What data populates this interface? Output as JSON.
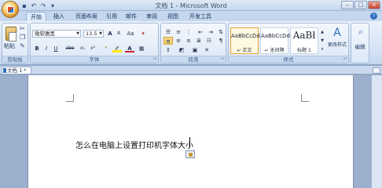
{
  "window": {
    "title": "文档 1 - Microsoft Word",
    "buttons": {
      "minimize": "–",
      "maximize": "□",
      "close": "×"
    }
  },
  "qat": {
    "save_icon": "save-icon",
    "undo_icon": "undo-icon",
    "redo_icon": "redo-icon"
  },
  "tabs": [
    {
      "label": "开始",
      "active": true
    },
    {
      "label": "插入"
    },
    {
      "label": "页面布局"
    },
    {
      "label": "引用"
    },
    {
      "label": "邮件"
    },
    {
      "label": "审阅"
    },
    {
      "label": "视图"
    },
    {
      "label": "开发工具"
    }
  ],
  "ribbon": {
    "clipboard": {
      "label": "剪贴板",
      "paste": "粘贴"
    },
    "font": {
      "label": "字体",
      "name": "微软雅黑",
      "size": "13.5",
      "bold": "B",
      "italic": "I",
      "underline": "U",
      "strike": "abe",
      "sub": "x₂",
      "sup": "x²",
      "aa": "Aa",
      "grow": "A",
      "shrink": "A"
    },
    "paragraph": {
      "label": "段落"
    },
    "styles": {
      "label": "样式",
      "items": [
        {
          "sample": "AaBbCcDd",
          "name": "↵ 正文",
          "selected": true
        },
        {
          "sample": "AaBbCcDd",
          "name": "↵ 无间隔"
        },
        {
          "sample": "AaBł",
          "name": "标题 1"
        }
      ],
      "change": "更改样式"
    },
    "editing": {
      "label": "编辑"
    }
  },
  "doc_tab": {
    "label": "文档 1 *"
  },
  "document": {
    "text": "怎么在电脑上设置打印机字体大小"
  },
  "colors": {
    "accent": "#2f6fbf",
    "selected_style": "#e6a33a"
  }
}
